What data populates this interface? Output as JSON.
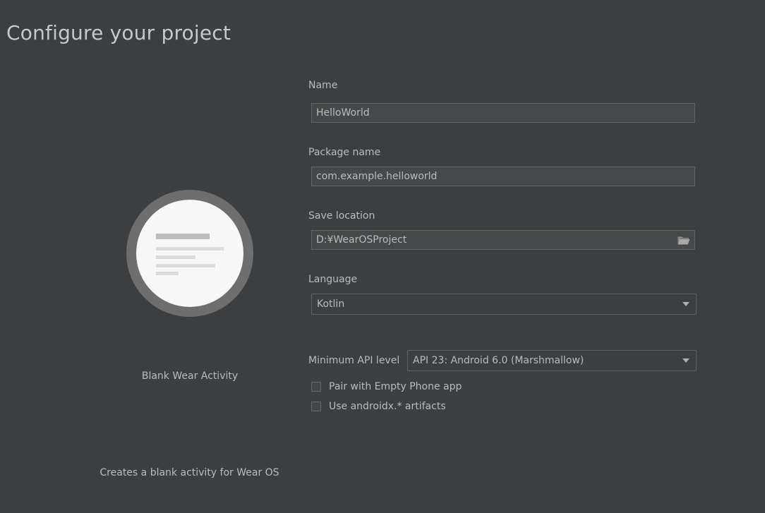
{
  "page": {
    "title": "Configure your project"
  },
  "template": {
    "name": "Blank Wear Activity",
    "description": "Creates a blank activity for Wear OS"
  },
  "form": {
    "name": {
      "label": "Name",
      "value": "HelloWorld"
    },
    "package_name": {
      "label": "Package name",
      "value": "com.example.helloworld"
    },
    "save_location": {
      "label": "Save location",
      "value": "D:¥WearOSProject",
      "icon": "folder-icon"
    },
    "language": {
      "label": "Language",
      "selected": "Kotlin"
    },
    "min_api": {
      "label": "Minimum API level",
      "selected": "API 23: Android 6.0 (Marshmallow)"
    },
    "checkboxes": [
      {
        "label": "Pair with Empty Phone app",
        "checked": false
      },
      {
        "label": "Use androidx.* artifacts",
        "checked": false
      }
    ]
  },
  "colors": {
    "background": "#3c3f41",
    "field_background": "#45494a",
    "text": "#bbbbbb"
  }
}
